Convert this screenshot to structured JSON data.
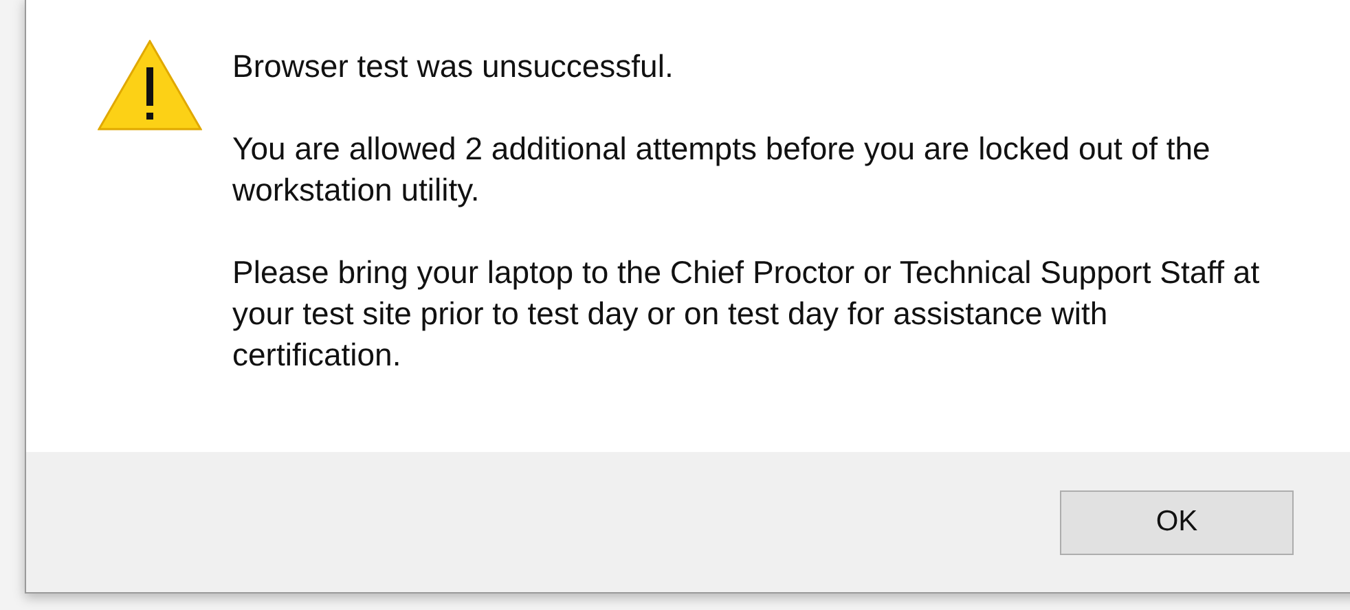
{
  "dialog": {
    "kind": "warning",
    "messages": [
      "Browser test was unsuccessful.",
      "You are allowed 2 additional attempts before you are locked out of the workstation utility.",
      "Please bring your laptop to the Chief Proctor or Technical Support Staff at your test site prior to test day or on test day for assistance with certification."
    ],
    "buttons": [
      "OK"
    ]
  }
}
